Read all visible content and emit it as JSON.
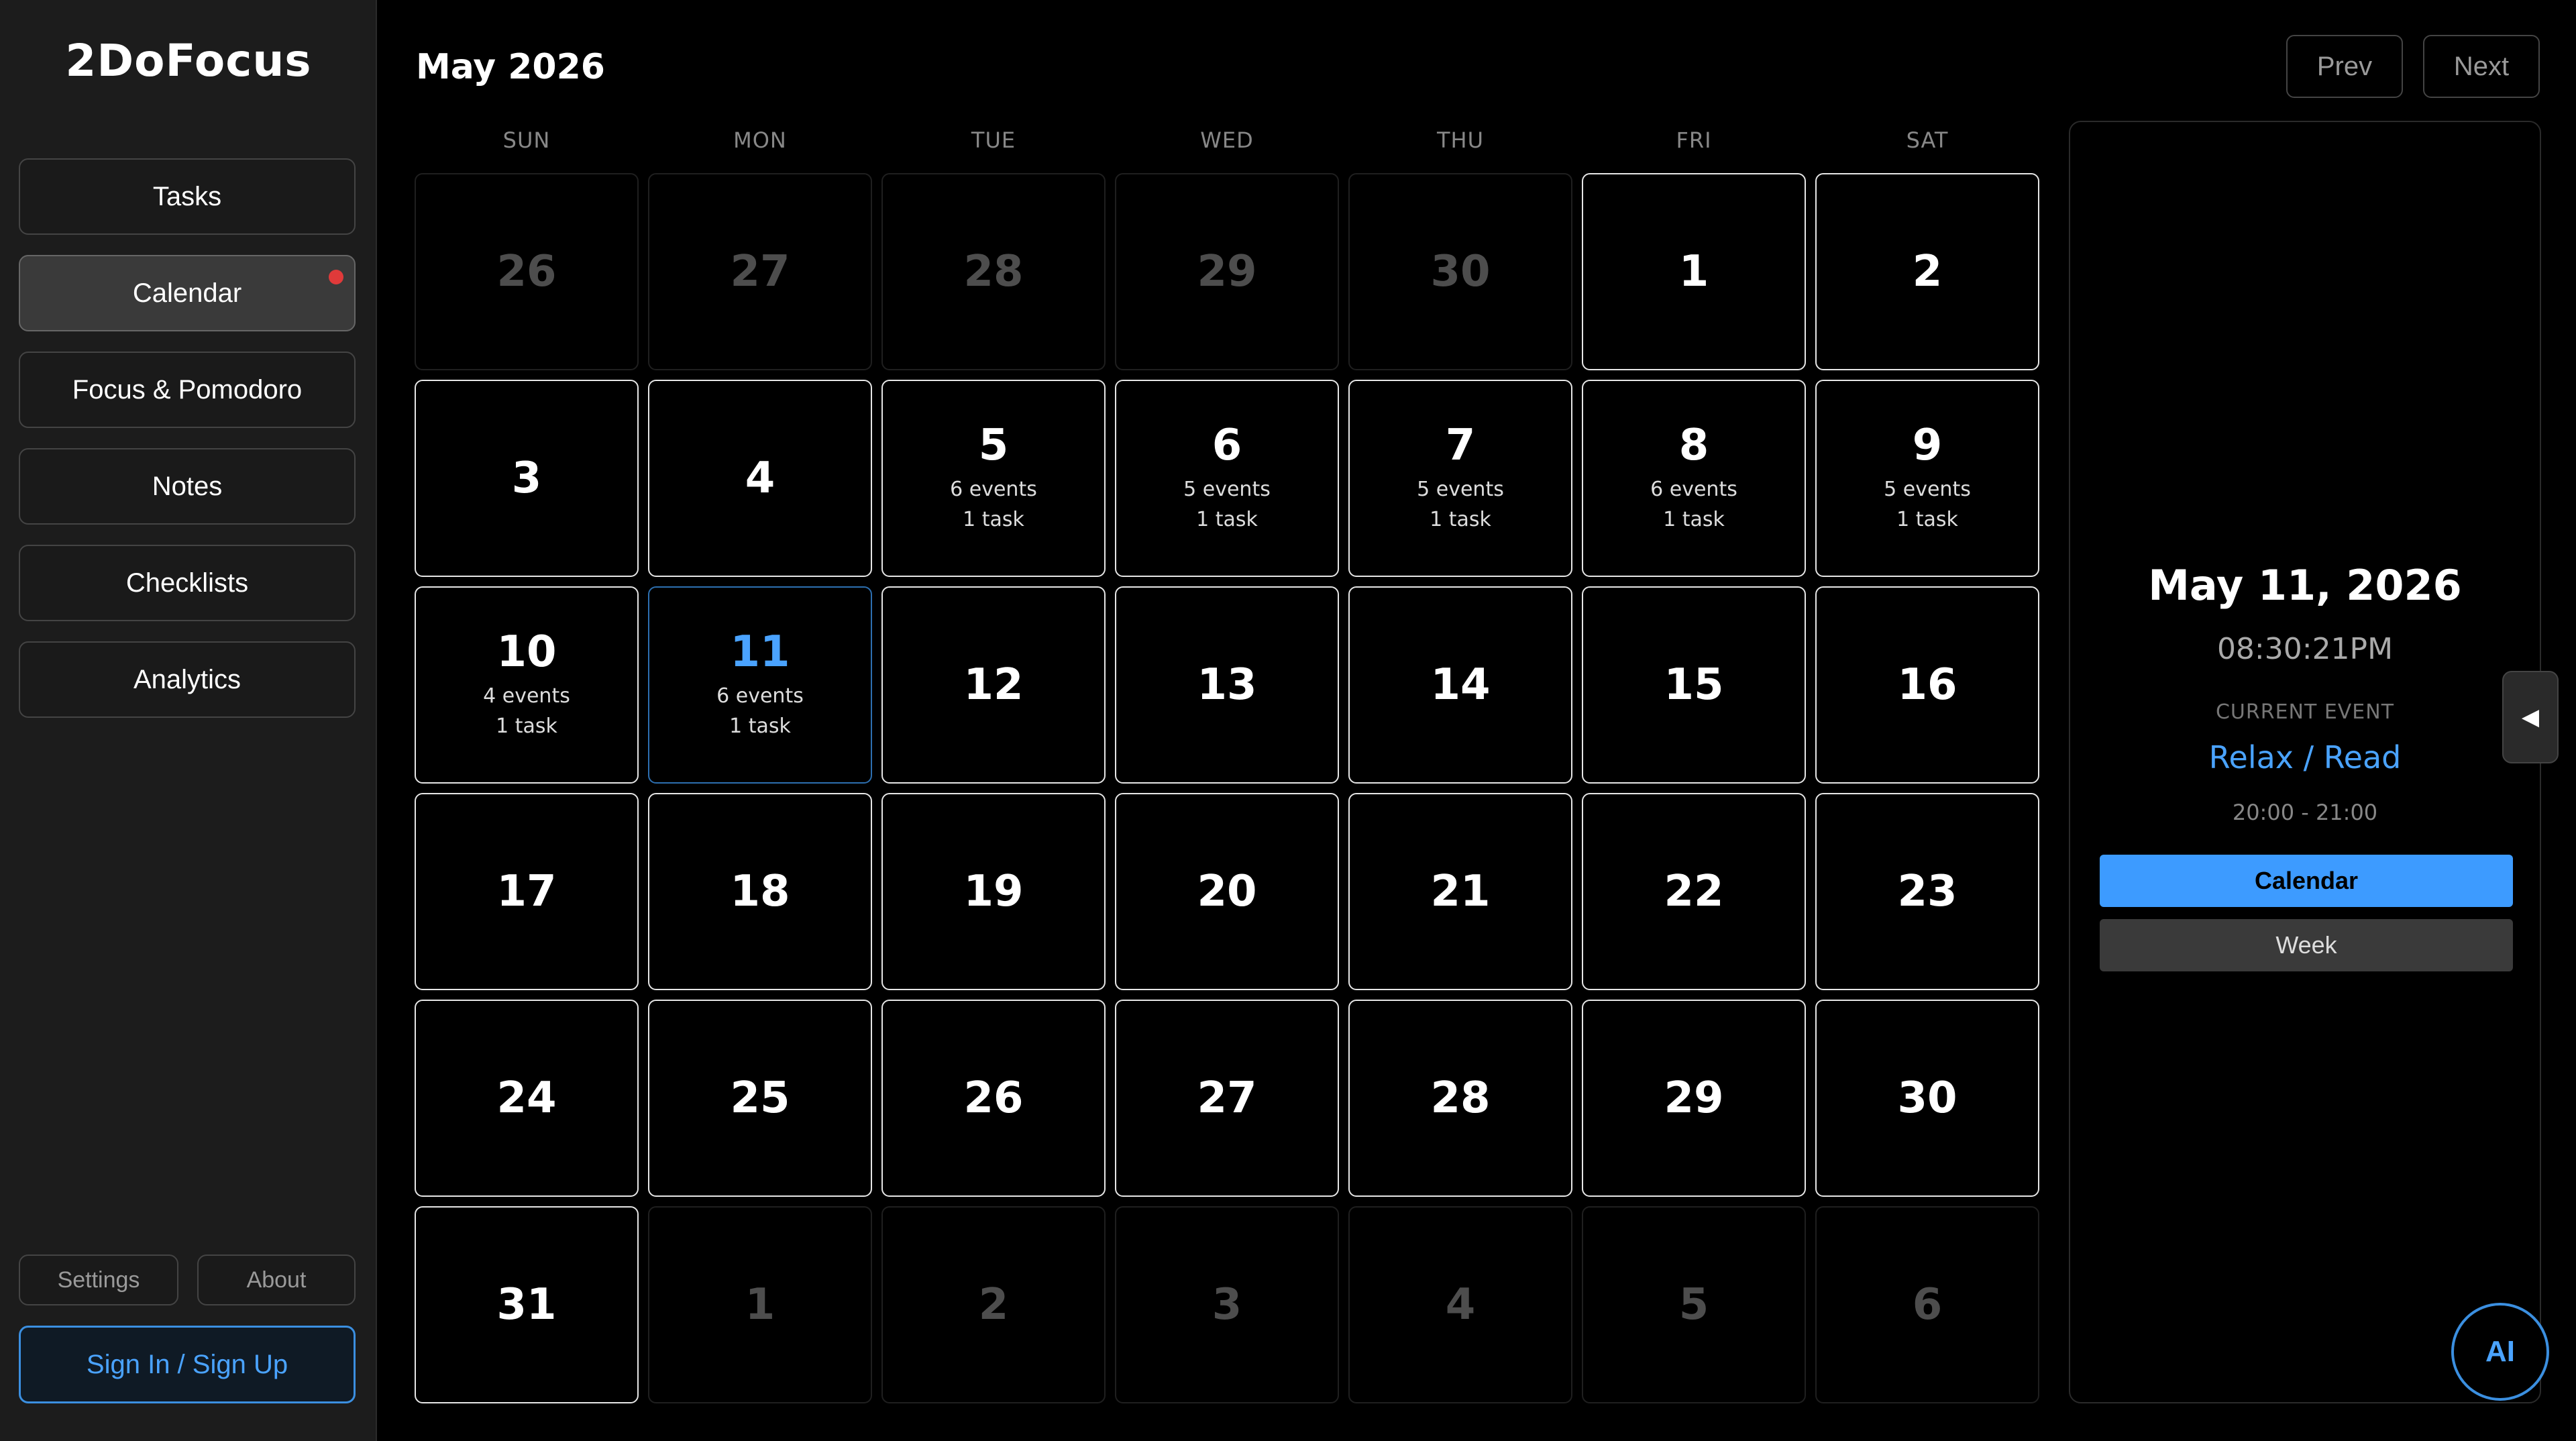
{
  "sidebar": {
    "title": "2DoFocus",
    "items": [
      {
        "label": "Tasks"
      },
      {
        "label": "Calendar"
      },
      {
        "label": "Focus & Pomodoro"
      },
      {
        "label": "Notes"
      },
      {
        "label": "Checklists"
      },
      {
        "label": "Analytics"
      }
    ],
    "settings_label": "Settings",
    "about_label": "About",
    "signin_label": "Sign In / Sign Up"
  },
  "header": {
    "month": "May 2026",
    "prev_label": "Prev",
    "next_label": "Next"
  },
  "calendar": {
    "weekdays": [
      "SUN",
      "MON",
      "TUE",
      "WED",
      "THU",
      "FRI",
      "SAT"
    ],
    "days": [
      {
        "num": "26",
        "muted": true
      },
      {
        "num": "27",
        "muted": true
      },
      {
        "num": "28",
        "muted": true
      },
      {
        "num": "29",
        "muted": true
      },
      {
        "num": "30",
        "muted": true
      },
      {
        "num": "1"
      },
      {
        "num": "2"
      },
      {
        "num": "3"
      },
      {
        "num": "4"
      },
      {
        "num": "5",
        "events": "6 events",
        "tasks": "1 task"
      },
      {
        "num": "6",
        "events": "5 events",
        "tasks": "1 task"
      },
      {
        "num": "7",
        "events": "5 events",
        "tasks": "1 task"
      },
      {
        "num": "8",
        "events": "6 events",
        "tasks": "1 task"
      },
      {
        "num": "9",
        "events": "5 events",
        "tasks": "1 task"
      },
      {
        "num": "10",
        "events": "4 events",
        "tasks": "1 task"
      },
      {
        "num": "11",
        "events": "6 events",
        "tasks": "1 task",
        "today": true
      },
      {
        "num": "12"
      },
      {
        "num": "13"
      },
      {
        "num": "14"
      },
      {
        "num": "15"
      },
      {
        "num": "16"
      },
      {
        "num": "17"
      },
      {
        "num": "18"
      },
      {
        "num": "19"
      },
      {
        "num": "20"
      },
      {
        "num": "21"
      },
      {
        "num": "22"
      },
      {
        "num": "23"
      },
      {
        "num": "24"
      },
      {
        "num": "25"
      },
      {
        "num": "26"
      },
      {
        "num": "27"
      },
      {
        "num": "28"
      },
      {
        "num": "29"
      },
      {
        "num": "30"
      },
      {
        "num": "31"
      },
      {
        "num": "1",
        "muted": true
      },
      {
        "num": "2",
        "muted": true
      },
      {
        "num": "3",
        "muted": true
      },
      {
        "num": "4",
        "muted": true
      },
      {
        "num": "5",
        "muted": true
      },
      {
        "num": "6",
        "muted": true
      }
    ]
  },
  "panel": {
    "date": "May 11, 2026",
    "time": "08:30:21PM",
    "current_label": "CURRENT EVENT",
    "event_name": "Relax / Read",
    "event_range": "20:00 - 21:00",
    "calendar_btn": "Calendar",
    "week_btn": "Week",
    "collapse_icon": "◀"
  },
  "ai_label": "AI",
  "colors": {
    "accent": "#4aa3ff",
    "notification": "#e03a3a",
    "today_border": "#2d6fb0"
  }
}
